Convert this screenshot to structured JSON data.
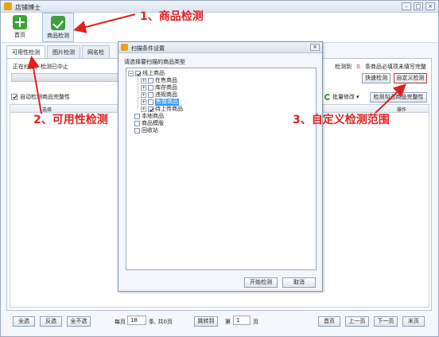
{
  "window": {
    "title": "店铺博士"
  },
  "toolbar": {
    "items": [
      {
        "label": "首页",
        "icon": "plus-icon"
      },
      {
        "label": "商品检测",
        "icon": "check-icon"
      }
    ]
  },
  "tabs": [
    {
      "label": "可用性检测",
      "active": true
    },
    {
      "label": "图片检测",
      "active": false
    },
    {
      "label": "网名检",
      "active": false
    }
  ],
  "scan": {
    "status": "正在扫描，检测已中止"
  },
  "auto_check": {
    "label": "自动检测商品完整性",
    "checked": true
  },
  "right_panel": {
    "detected_label": "检测到",
    "count": "0",
    "suffix": "条商品必填项未填写完整",
    "quick_check": "快速检测",
    "custom_check": "自定义检测",
    "batch_edit": "批量修改",
    "check_selected": "检测勾选商品完整性"
  },
  "grid": {
    "col_select": "选择",
    "col_op": "操作"
  },
  "bottom": {
    "select_all": "全选",
    "invert": "反选",
    "select_none": "全不选",
    "per_page_label": "每页",
    "per_page_value": "18",
    "per_page_suffix": "条, 共0页",
    "goto": "跳转到",
    "page_prefix": "第",
    "page_value": "1",
    "page_suffix": "页",
    "first": "首页",
    "prev": "上一页",
    "next": "下一页",
    "last": "末页"
  },
  "dialog": {
    "title": "扫描条件设置",
    "prompt": "请选择要扫描的商品类型",
    "tree": {
      "root": "线上商品",
      "children": [
        "在售商品",
        "库存商品",
        "违规商品",
        "售罄商品",
        "待上传商品"
      ],
      "others": [
        "本地商品",
        "商品模版",
        "回收站"
      ]
    },
    "start_button": "开始检测",
    "cancel_button": "取消"
  },
  "annotations": {
    "a1": "1、商品检测",
    "a2": "2、可用性检测",
    "a3": "3、自定义检测范围"
  },
  "colors": {
    "annotation": "#e02020",
    "highlight": "#3399ff",
    "accent_green": "#3aa63a"
  }
}
